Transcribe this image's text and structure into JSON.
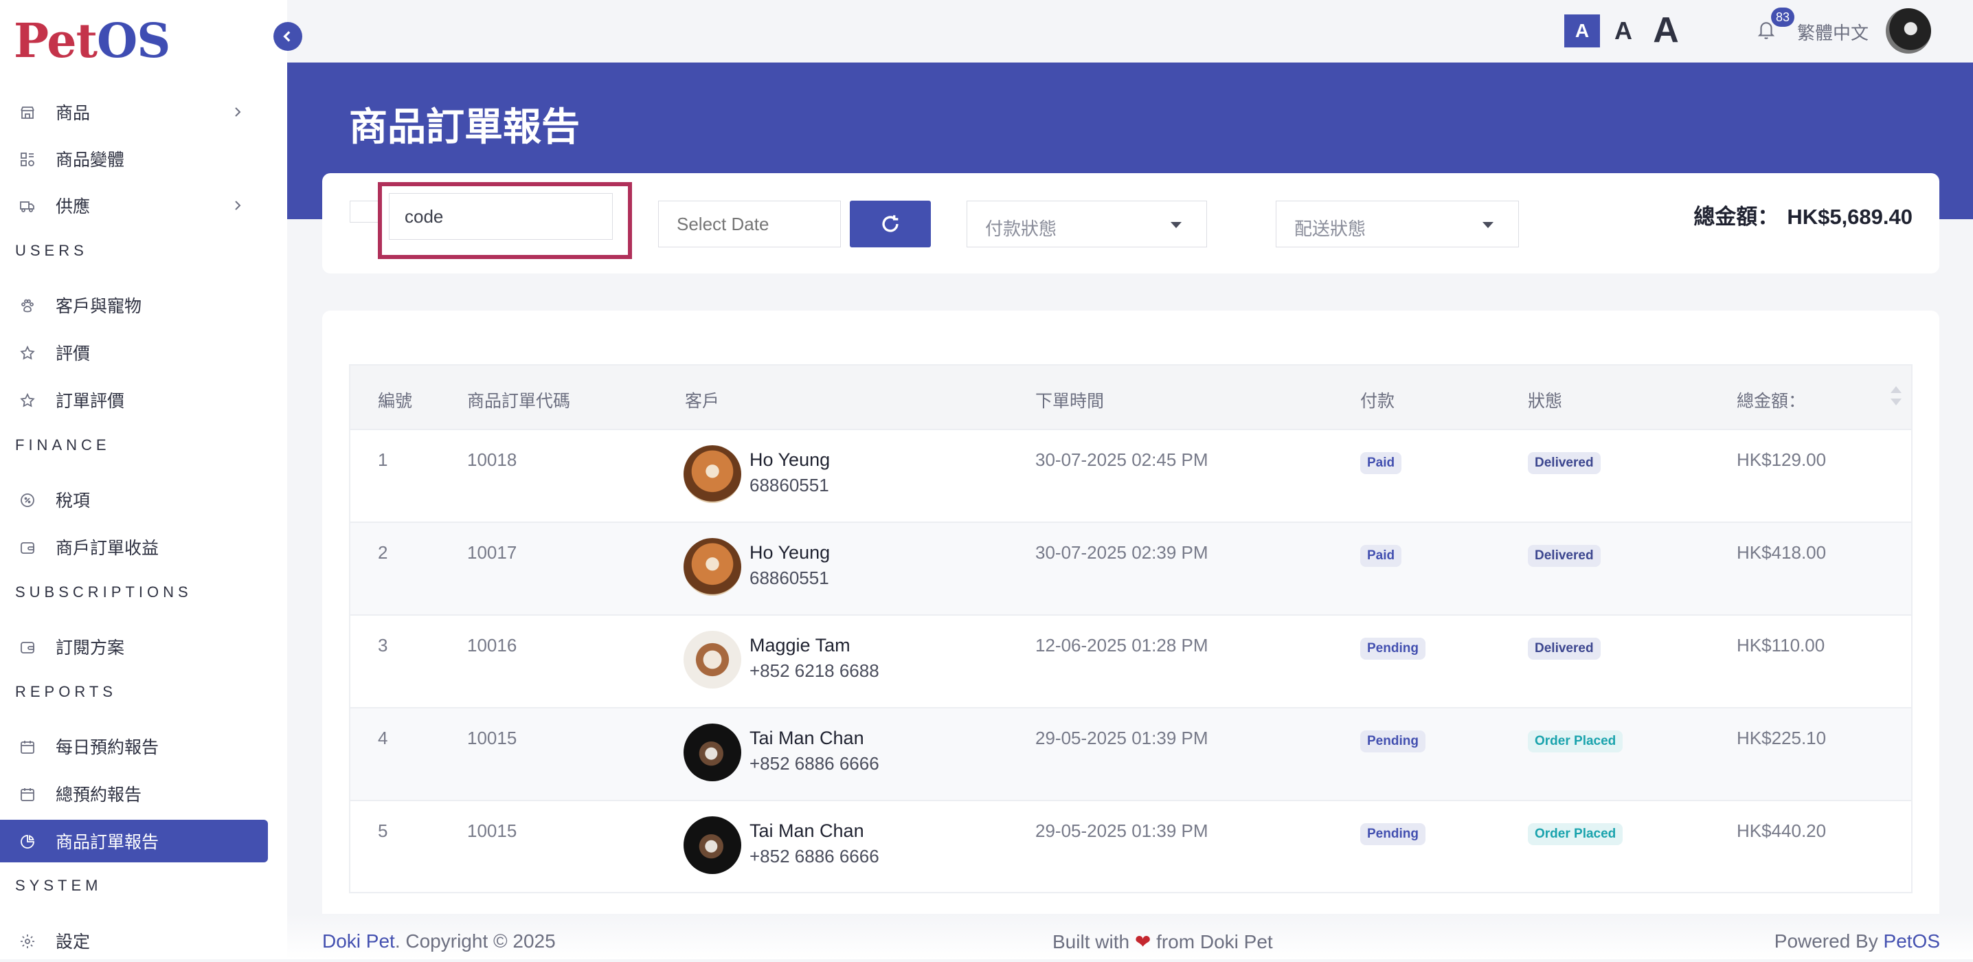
{
  "logo": {
    "part1": "Pet",
    "part2": "OS"
  },
  "sidebar": {
    "items": [
      {
        "label": "商品",
        "icon": "store-icon",
        "chevron": true
      },
      {
        "label": "商品變體",
        "icon": "variants-icon",
        "chevron": false
      },
      {
        "label": "供應",
        "icon": "truck-icon",
        "chevron": true
      },
      {
        "label": "客戶與寵物",
        "icon": "paw-icon",
        "chevron": false
      },
      {
        "label": "評價",
        "icon": "star-icon",
        "chevron": false
      },
      {
        "label": "訂單評價",
        "icon": "star-icon",
        "chevron": false
      },
      {
        "label": "稅項",
        "icon": "tax-icon",
        "chevron": false
      },
      {
        "label": "商戶訂單收益",
        "icon": "wallet-icon",
        "chevron": false
      },
      {
        "label": "訂閱方案",
        "icon": "wallet-icon",
        "chevron": false
      },
      {
        "label": "每日預約報告",
        "icon": "calendar-icon",
        "chevron": false
      },
      {
        "label": "總預約報告",
        "icon": "calendar-icon",
        "chevron": false
      },
      {
        "label": "商品訂單報告",
        "icon": "pie-chart-icon",
        "chevron": false,
        "active": true
      },
      {
        "label": "設定",
        "icon": "gear-icon",
        "chevron": false
      }
    ],
    "sections": [
      "USERS",
      "FINANCE",
      "SUBSCRIPTIONS",
      "REPORTS",
      "SYSTEM"
    ]
  },
  "topbar": {
    "font_small": "A",
    "font_mid": "A",
    "font_big": "A",
    "notification_count": "83",
    "language": "繁體中文"
  },
  "page": {
    "title": "商品訂單報告"
  },
  "filters": {
    "code_value": "code",
    "date_placeholder": "Select Date",
    "payment_status": "付款狀態",
    "delivery_status": "配送狀態",
    "total_label": "總金額：",
    "total_value": "HK$5,689.40"
  },
  "table": {
    "headers": [
      "編號",
      "商品訂單代碼",
      "客戶",
      "下單時間",
      "付款",
      "狀態",
      "總金額："
    ],
    "rows": [
      {
        "no": "1",
        "code": "10018",
        "name": "Ho Yeung",
        "phone": "68860551",
        "time": "30-07-2025 02:45 PM",
        "payment": "Paid",
        "status": "Delivered",
        "total": "HK$129.00",
        "avatar": "dog"
      },
      {
        "no": "2",
        "code": "10017",
        "name": "Ho Yeung",
        "phone": "68860551",
        "time": "30-07-2025 02:39 PM",
        "payment": "Paid",
        "status": "Delivered",
        "total": "HK$418.00",
        "avatar": "dog"
      },
      {
        "no": "3",
        "code": "10016",
        "name": "Maggie Tam",
        "phone": "+852 6218 6688",
        "time": "12-06-2025 01:28 PM",
        "payment": "Pending",
        "status": "Delivered",
        "total": "HK$110.00",
        "avatar": "cat"
      },
      {
        "no": "4",
        "code": "10015",
        "name": "Tai Man Chan",
        "phone": "+852 6886 6666",
        "time": "29-05-2025 01:39 PM",
        "payment": "Pending",
        "status": "Order Placed",
        "total": "HK$225.10",
        "avatar": "dark"
      },
      {
        "no": "5",
        "code": "10015",
        "name": "Tai Man Chan",
        "phone": "+852 6886 6666",
        "time": "29-05-2025 01:39 PM",
        "payment": "Pending",
        "status": "Order Placed",
        "total": "HK$440.20",
        "avatar": "dark"
      }
    ]
  },
  "footer": {
    "left_brand": "Doki Pet",
    "left_rest": ". Copyright © 2025",
    "center_pre": "Built with ",
    "center_heart": "❤",
    "center_post": " from Doki Pet",
    "right_pre": "Powered By ",
    "right_brand": "PetOS"
  },
  "colors": {
    "primary": "#4350b0",
    "accent": "#c4334a",
    "highlight": "#b0305a"
  }
}
